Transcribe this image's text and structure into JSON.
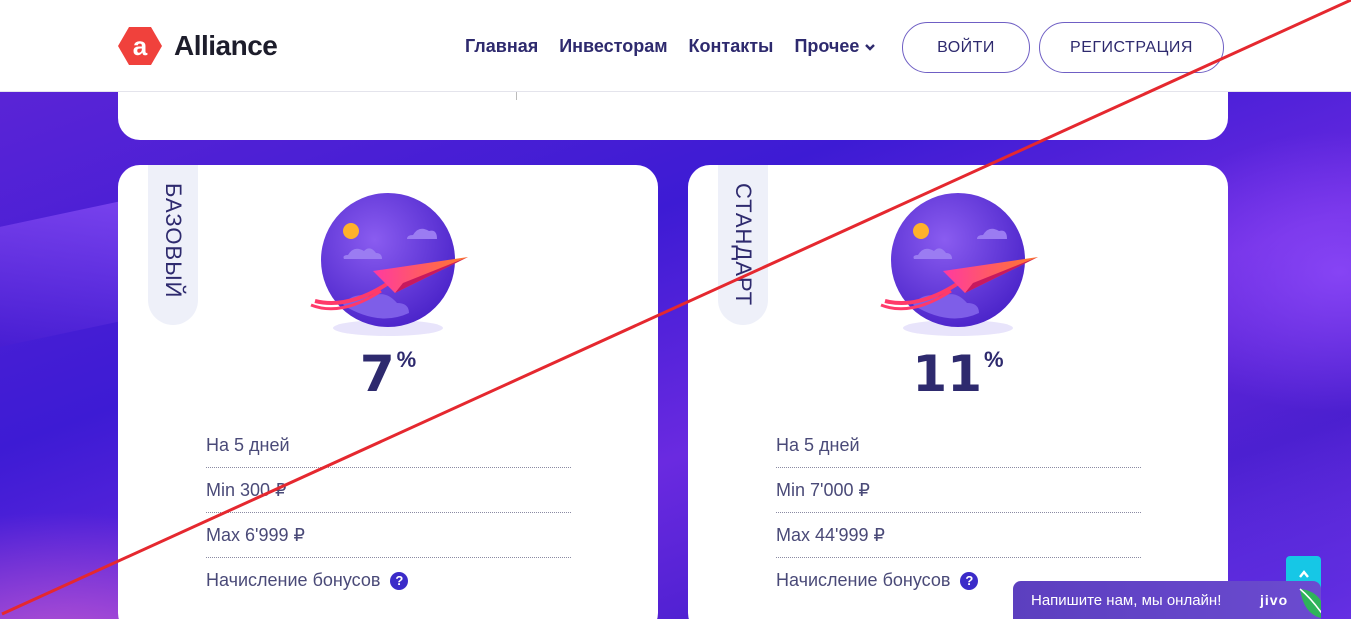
{
  "header": {
    "logo_letter": "a",
    "logo_text": "Alliance",
    "nav": [
      "Главная",
      "Инвесторам",
      "Контакты",
      "Прочее"
    ],
    "login_label": "ВОЙТИ",
    "register_label": "РЕГИСТРАЦИЯ"
  },
  "plans": [
    {
      "name": "БАЗОВЫЙ",
      "percent": "7",
      "percent_symbol": "%",
      "rows": [
        "На 5 дней",
        "Min 300 ₽",
        "Max 6'999 ₽",
        "Начисление бонусов"
      ],
      "help": "?"
    },
    {
      "name": "СТАНДАРТ",
      "percent": "11",
      "percent_symbol": "%",
      "rows": [
        "На 5 дней",
        "Min 7'000 ₽",
        "Max 44'999 ₽",
        "Начисление бонусов"
      ],
      "help": "?"
    }
  ],
  "chat": {
    "text": "Напишите нам, мы онлайн!",
    "brand": "jivo"
  },
  "colors": {
    "accent": "#2e2a6e",
    "logo": "#f0413c",
    "strike": "#e5282f",
    "scroll_button": "#16c7e6",
    "chat_bg": "#5c3fbf"
  }
}
